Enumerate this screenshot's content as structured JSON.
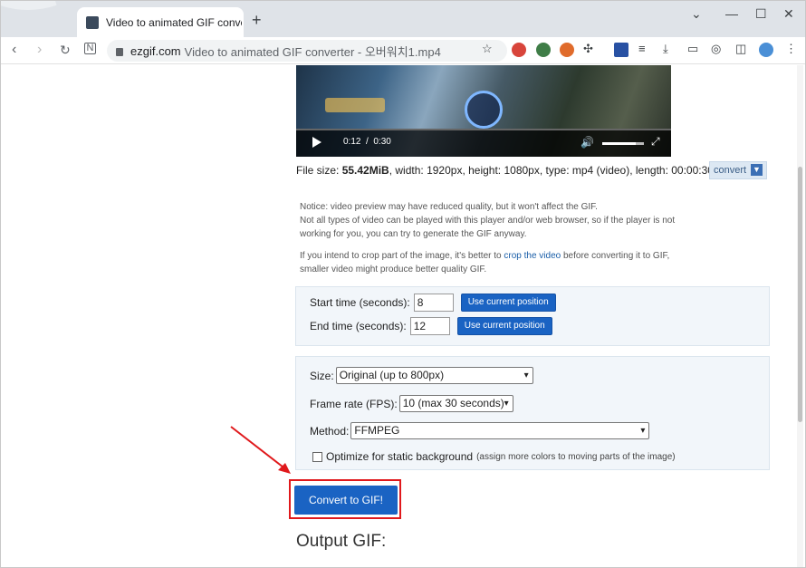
{
  "browser": {
    "tab_title": "Video to animated GIF converter",
    "new_tab_icon": "+",
    "url_host": "ezgif.com",
    "url_rest": "Video to animated GIF converter - 오버워치1.mp4"
  },
  "video": {
    "time_current": "0:12",
    "time_separator": "/",
    "time_total": "0:30"
  },
  "fileinfo": {
    "prefix": "File size: ",
    "size": "55.42MiB",
    "details": ", width: 1920px, height: 1080px, type: mp4 (video), length: 00:00:30",
    "convert_label": "convert"
  },
  "notice": {
    "line1": "Notice: video preview may have reduced quality, but it won't affect the GIF.",
    "line2": "Not all types of video can be played with this player and/or web browser, so if the player is not working for you, you can try to generate the GIF anyway.",
    "crop_before": "If you intend to crop part of the image, it's better to ",
    "crop_link": "crop the video",
    "crop_after": " before converting it to GIF, smaller video might produce better quality GIF."
  },
  "timing": {
    "start_label": "Start time (seconds):",
    "start_value": "8",
    "end_label": "End time (seconds):",
    "end_value": "12",
    "use_current_label": "Use current position"
  },
  "options": {
    "size_label": "Size:",
    "size_value": "Original (up to 800px)",
    "fps_label": "Frame rate (FPS):",
    "fps_value": "10 (max 30 seconds)",
    "method_label": "Method:",
    "method_value": "FFMPEG",
    "optimize_label": "Optimize for static background",
    "optimize_note": "(assign more colors to moving parts of the image)",
    "optimize_checked": false
  },
  "actions": {
    "convert_button": "Convert to GIF!"
  },
  "output": {
    "title": "Output GIF:"
  },
  "colors": {
    "accent": "#1a63c3",
    "highlight": "#e0191c"
  }
}
